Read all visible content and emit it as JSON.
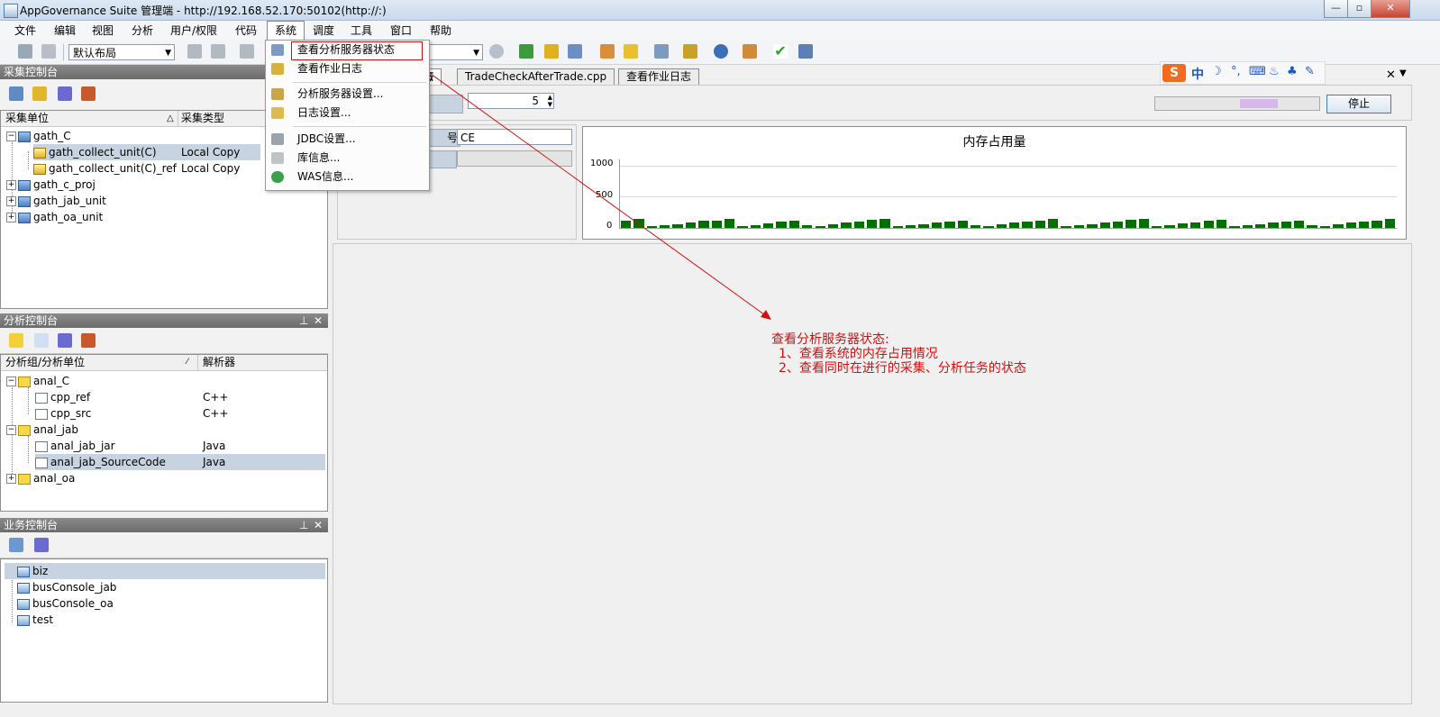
{
  "window": {
    "title": "AppGovernance Suite 管理端 - http://192.168.52.170:50102(http://:)"
  },
  "menubar": {
    "items": [
      "文件",
      "编辑",
      "视图",
      "分析",
      "用户/权限",
      "代码",
      "系统",
      "调度",
      "工具",
      "窗口",
      "帮助"
    ]
  },
  "toolbar": {
    "layout_combo": "默认布局"
  },
  "system_menu": {
    "items": [
      "查看分析服务器状态",
      "查看作业日志",
      "分析服务器设置...",
      "日志设置...",
      "JDBC设置...",
      "库信息...",
      "WAS信息..."
    ]
  },
  "collect_panel": {
    "title": "采集控制台",
    "columns": [
      "采集单位",
      "采集类型"
    ],
    "rows": [
      {
        "name": "gath_C",
        "type": ""
      },
      {
        "name": "gath_collect_unit(C)",
        "type": "Local Copy"
      },
      {
        "name": "gath_collect_unit(C)_ref",
        "type": "Local Copy"
      },
      {
        "name": "gath_c_proj",
        "type": ""
      },
      {
        "name": "gath_jab_unit",
        "type": ""
      },
      {
        "name": "gath_oa_unit",
        "type": ""
      }
    ]
  },
  "analysis_panel": {
    "title": "分析控制台",
    "columns": [
      "分析组/分析单位",
      "解析器"
    ],
    "rows": [
      {
        "name": "anal_C",
        "parser": ""
      },
      {
        "name": "cpp_ref",
        "parser": "C++"
      },
      {
        "name": "cpp_src",
        "parser": "C++"
      },
      {
        "name": "anal_jab",
        "parser": ""
      },
      {
        "name": "anal_jab_jar",
        "parser": "Java"
      },
      {
        "name": "anal_jab_SourceCode",
        "parser": "Java"
      },
      {
        "name": "anal_oa",
        "parser": ""
      }
    ]
  },
  "business_panel": {
    "title": "业务控制台",
    "rows": [
      "biz",
      "busConsole_jab",
      "busConsole_oa",
      "test"
    ]
  },
  "tabs": [
    "状态",
    "TradeCheckAfterTrade.cpp",
    "查看作业日志"
  ],
  "status_view": {
    "spinner_value": "5",
    "stop_button": "停止",
    "label_partial": "号",
    "field_value": "CE"
  },
  "ime_bar": {
    "mode": "中"
  },
  "chart_data": {
    "type": "bar",
    "title": "内存占用量",
    "y_ticks": [
      "1000",
      "500",
      "0"
    ],
    "ylim": [
      0,
      1100
    ],
    "values": [
      110,
      140,
      30,
      40,
      60,
      90,
      110,
      120,
      150,
      30,
      50,
      70,
      100,
      110,
      40,
      30,
      60,
      80,
      100,
      130,
      150,
      30,
      40,
      60,
      80,
      100,
      120,
      40,
      30,
      60,
      80,
      100,
      120,
      150,
      30,
      40,
      60,
      80,
      100,
      130,
      150,
      30,
      50,
      70,
      90,
      110,
      130,
      30,
      40,
      60,
      80,
      100,
      120,
      40,
      30,
      60,
      80,
      100,
      120,
      150
    ]
  },
  "annotation": {
    "line1": "查看分析服务器状态:",
    "line2": "1、查看系统的内存占用情况",
    "line3": "2、查看同时在进行的采集、分析任务的状态"
  },
  "colors": {
    "bar": "#007000",
    "annotation": "#d01010",
    "highlight_box": "#d01010"
  }
}
